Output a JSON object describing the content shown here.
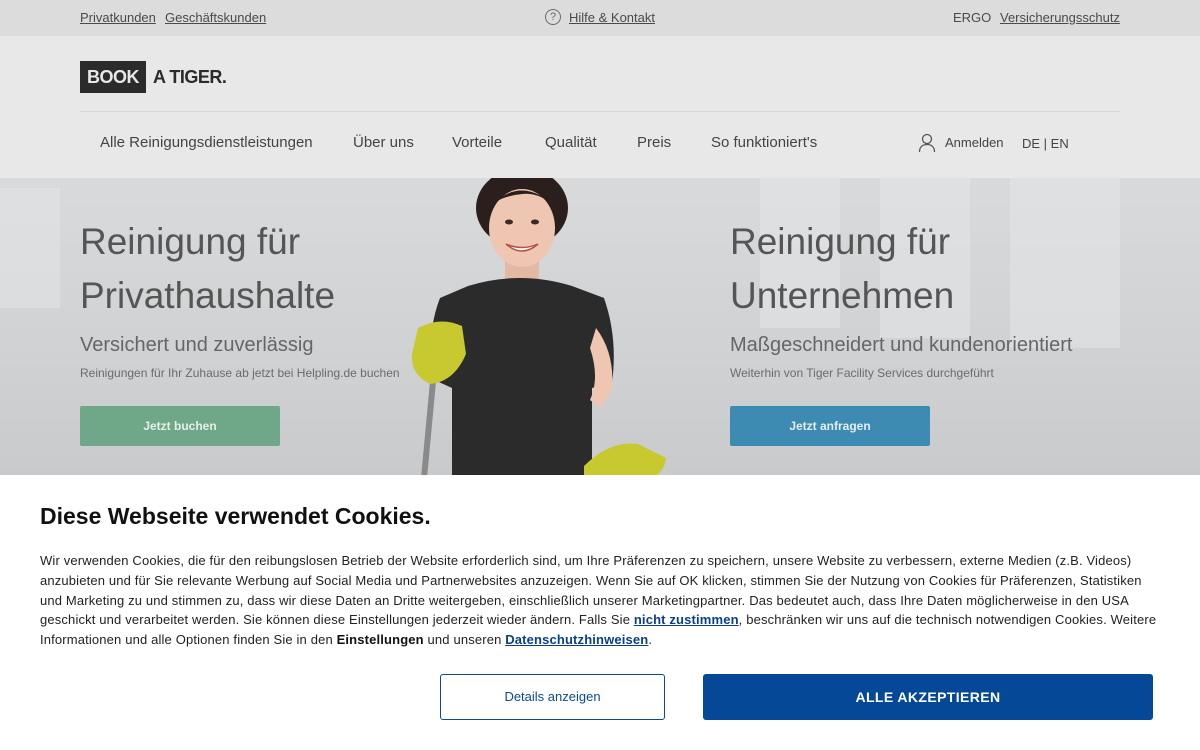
{
  "topbar": {
    "privatkunden": "Privatkunden",
    "geschaeftskunden": "Geschäftskunden",
    "help_icon": "?",
    "hilfe": "Hilfe & Kontakt",
    "ergo": "ERGO",
    "versicherungsschutz": "Versicherungsschutz"
  },
  "logo": {
    "book": "BOOK",
    "tiger": "A TIGER."
  },
  "nav": {
    "items": [
      "Alle Reinigungsdienstleistungen",
      "Über uns",
      "Vorteile",
      "Qualität",
      "Preis",
      "So funktioniert's"
    ],
    "login": "Anmelden",
    "lang": "DE | EN"
  },
  "hero": {
    "left": {
      "title_line1": "Reinigung für",
      "title_line2": "Privathaushalte",
      "subtitle": "Versichert und zuverlässig",
      "small": "Reinigungen für Ihr Zuhause ab jetzt bei Helpling.de buchen",
      "button": "Jetzt buchen"
    },
    "right": {
      "title_line1": "Reinigung für",
      "title_line2": "Unternehmen",
      "subtitle": "Maßgeschneidert und kundenorientiert",
      "small": "Weiterhin von Tiger Facility Services durchgeführt",
      "button": "Jetzt anfragen"
    }
  },
  "cookie": {
    "title": "Diese Webseite verwendet Cookies.",
    "text_1": "Wir verwenden Cookies, die für den reibungslosen Betrieb der Website erforderlich sind, um Ihre Präferenzen zu speichern, unsere Website zu verbessern, externe Medien (z.B. Videos) anzubieten und für Sie relevante Werbung auf Social Media und Partnerwebsites anzuzeigen. Wenn Sie auf OK klicken, stimmen Sie der Nutzung von Cookies für Präferenzen, Statistiken und Marketing zu und stimmen zu, dass wir diese Daten an Dritte weitergeben, einschließlich unserer Marketingpartner. Das bedeutet auch, dass Ihre Daten möglicherweise in den USA geschickt und verarbeitet werden. Sie können diese Einstellungen jederzeit wieder ändern. Falls Sie ",
    "link_reject": "nicht zustimmen",
    "text_2": ", beschränken wir uns auf die technisch notwendigen Cookies. Weitere Informationen und alle Optionen finden Sie in den ",
    "settings": "Einstellungen",
    "text_3": " und unseren ",
    "link_privacy": "Datenschutzhinweisen",
    "text_4": ".",
    "details_button": "Details anzeigen",
    "accept_button": "ALLE AKZEPTIEREN"
  },
  "colors": {
    "accept": "#064898",
    "book_now": "#6ea888",
    "request_now": "#3d8ab2"
  }
}
